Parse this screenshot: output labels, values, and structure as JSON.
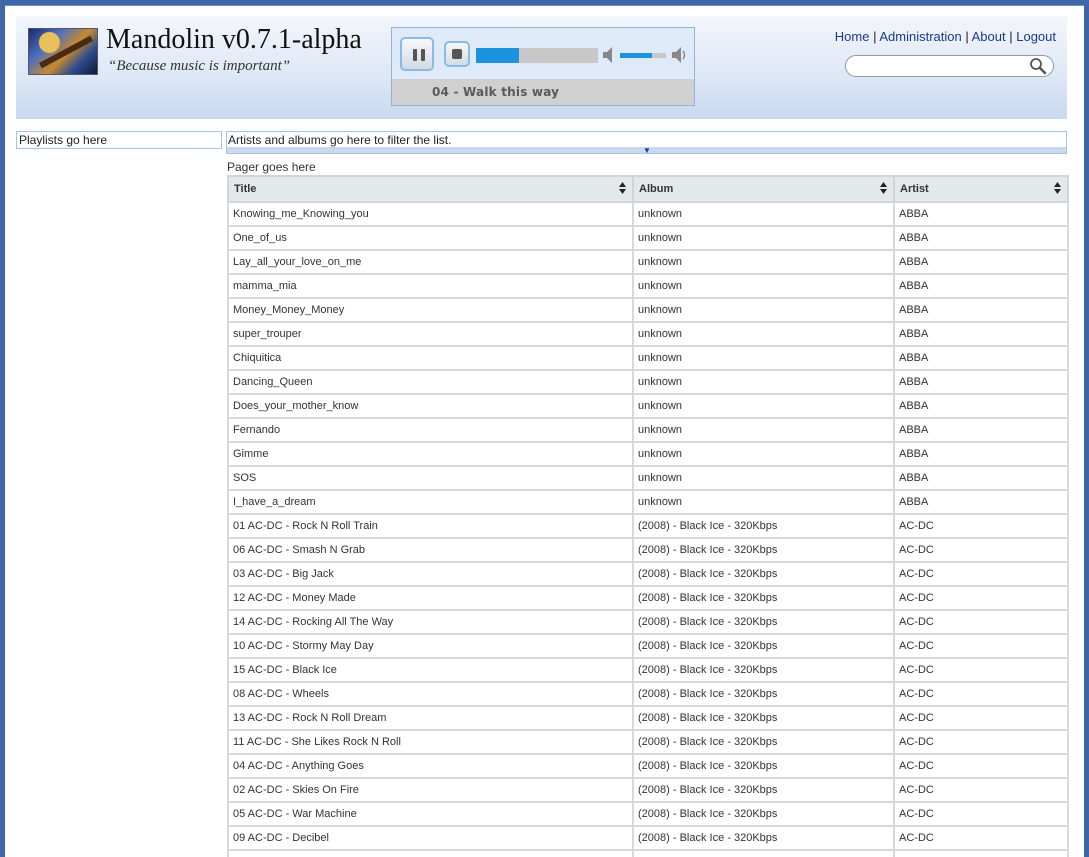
{
  "header": {
    "title": "Mandolin v0.7.1-alpha",
    "tagline": "“Because music is important”",
    "nav": [
      {
        "label": "Home"
      },
      {
        "label": "Administration"
      },
      {
        "label": "About"
      },
      {
        "label": "Logout"
      }
    ],
    "search": {
      "value": "",
      "placeholder": ""
    }
  },
  "player": {
    "now_playing": "04 - Walk this way",
    "progress": 0.35,
    "volume": 0.7,
    "accent_color": "#1c93dc"
  },
  "sidebar": {
    "playlists_placeholder": "Playlists go here"
  },
  "filter": {
    "placeholder": "Artists and albums go here to filter the list."
  },
  "pager": {
    "text": "Pager goes here"
  },
  "table": {
    "columns": [
      "Title",
      "Album",
      "Artist"
    ],
    "rows": [
      [
        "Knowing_me_Knowing_you",
        "unknown",
        "ABBA"
      ],
      [
        "One_of_us",
        "unknown",
        "ABBA"
      ],
      [
        "Lay_all_your_love_on_me",
        "unknown",
        "ABBA"
      ],
      [
        "mamma_mia",
        "unknown",
        "ABBA"
      ],
      [
        "Money_Money_Money",
        "unknown",
        "ABBA"
      ],
      [
        "super_trouper",
        "unknown",
        "ABBA"
      ],
      [
        "Chiquitica",
        "unknown",
        "ABBA"
      ],
      [
        "Dancing_Queen",
        "unknown",
        "ABBA"
      ],
      [
        "Does_your_mother_know",
        "unknown",
        "ABBA"
      ],
      [
        "Fernando",
        "unknown",
        "ABBA"
      ],
      [
        "Gimme",
        "unknown",
        "ABBA"
      ],
      [
        "SOS",
        "unknown",
        "ABBA"
      ],
      [
        "I_have_a_dream",
        "unknown",
        "ABBA"
      ],
      [
        "01 AC-DC - Rock N Roll Train",
        "(2008) - Black Ice - 320Kbps",
        "AC-DC"
      ],
      [
        "06 AC-DC - Smash N Grab",
        "(2008) - Black Ice - 320Kbps",
        "AC-DC"
      ],
      [
        "03 AC-DC - Big Jack",
        "(2008) - Black Ice - 320Kbps",
        "AC-DC"
      ],
      [
        "12 AC-DC - Money Made",
        "(2008) - Black Ice - 320Kbps",
        "AC-DC"
      ],
      [
        "14 AC-DC - Rocking All The Way",
        "(2008) - Black Ice - 320Kbps",
        "AC-DC"
      ],
      [
        "10 AC-DC - Stormy May Day",
        "(2008) - Black Ice - 320Kbps",
        "AC-DC"
      ],
      [
        "15 AC-DC - Black Ice",
        "(2008) - Black Ice - 320Kbps",
        "AC-DC"
      ],
      [
        "08 AC-DC - Wheels",
        "(2008) - Black Ice - 320Kbps",
        "AC-DC"
      ],
      [
        "13 AC-DC - Rock N Roll Dream",
        "(2008) - Black Ice - 320Kbps",
        "AC-DC"
      ],
      [
        "11 AC-DC - She Likes Rock N Roll",
        "(2008) - Black Ice - 320Kbps",
        "AC-DC"
      ],
      [
        "04 AC-DC - Anything Goes",
        "(2008) - Black Ice - 320Kbps",
        "AC-DC"
      ],
      [
        "02 AC-DC - Skies On Fire",
        "(2008) - Black Ice - 320Kbps",
        "AC-DC"
      ],
      [
        "05 AC-DC - War Machine",
        "(2008) - Black Ice - 320Kbps",
        "AC-DC"
      ],
      [
        "09 AC-DC - Decibel",
        "(2008) - Black Ice - 320Kbps",
        "AC-DC"
      ],
      [
        "",
        "",
        ""
      ]
    ]
  }
}
